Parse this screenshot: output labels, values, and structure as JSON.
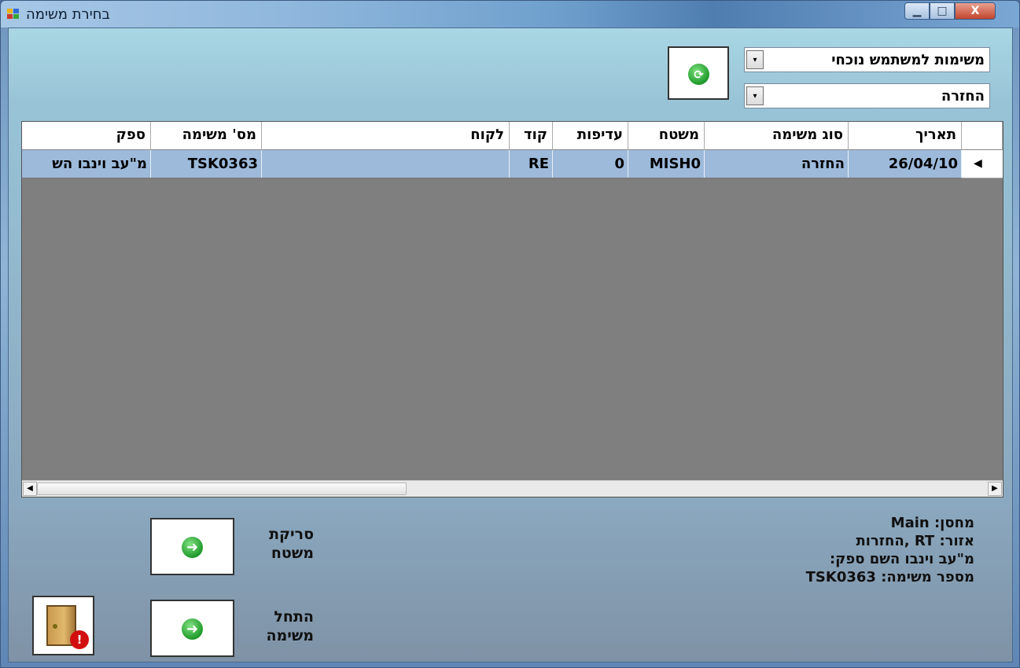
{
  "window": {
    "title": "בחירת משימה",
    "min_glyph": "▁",
    "max_glyph": "□",
    "close_glyph": "X"
  },
  "filters": {
    "list_value": "משימות למשתמש נוכחי",
    "type_value": "החזרה",
    "arrow_glyph": "▾",
    "refresh_icon": "refresh-icon"
  },
  "grid": {
    "columns": [
      "תאריך",
      "סוג משימה",
      "משטח",
      "עדיפות",
      "קוד",
      "לקוח",
      "מס' משימה",
      "ספק"
    ],
    "rows": [
      {
        "date": "26/04/10",
        "task_type": "החזרה",
        "pallet": "MISH0",
        "priority": "0",
        "code": "RE",
        "customer": "",
        "task_no": "TSK0363",
        "supplier": "מ\"עב וינבו הש"
      }
    ],
    "row_marker": "◀",
    "scroll_left": "◀",
    "scroll_right": "▶"
  },
  "info": {
    "warehouse": "מחסן: Main",
    "area": "אזור: RT ,החזרות",
    "supplier": "מ\"עב וינבו השם ספק:",
    "task_number": "מספר משימה: TSK0363"
  },
  "actions": {
    "scan_pallet_label": "סריקת משטח",
    "start_task_label": "התחל משימה",
    "go_glyph": "➜",
    "exit_icon": "exit-door-icon",
    "exit_badge": "!"
  },
  "colors": {
    "selected_row": "#9dbadb",
    "grid_background": "#7f7f7f",
    "go_green": "#1f9b2b",
    "exit_red": "#d20f0f"
  }
}
